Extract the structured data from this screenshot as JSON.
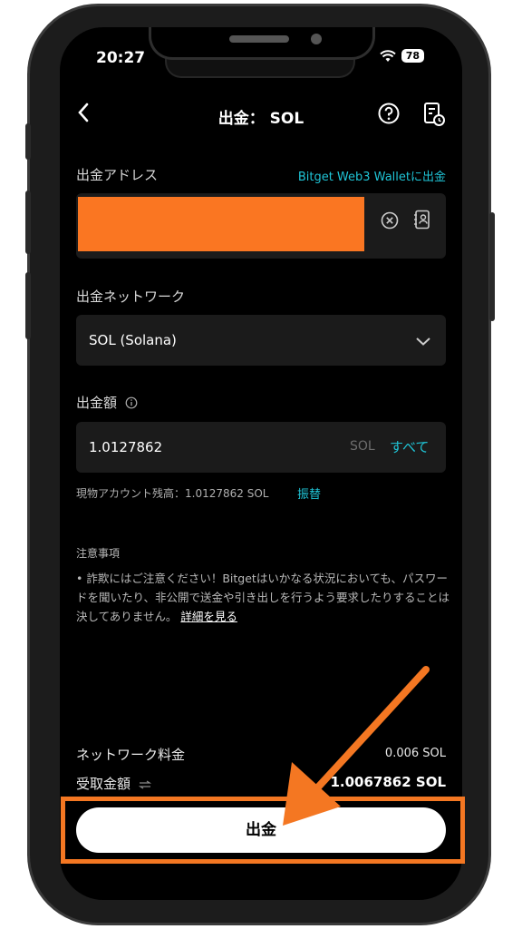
{
  "status_bar": {
    "time": "20:27",
    "battery": "78"
  },
  "header": {
    "title": "出金： SOL"
  },
  "address": {
    "label": "出金アドレス",
    "wallet_link": "Bitget Web3 Walletに出金"
  },
  "network": {
    "label": "出金ネットワーク",
    "value": "SOL (Solana)"
  },
  "amount": {
    "label": "出金額",
    "value": "1.0127862",
    "unit": "SOL",
    "all_label": "すべて"
  },
  "balance": {
    "text": "現物アカウント残高：1.0127862 SOL",
    "transfer_label": "振替"
  },
  "notes": {
    "title": "注意事項",
    "body": "• 詐欺にはご注意ください！Bitgetはいかなる状況においても、パスワードを聞いたり、非公開で送金や引き出しを行うよう要求したりすることは決してありません。",
    "link": "詳細を見る"
  },
  "fees": {
    "fee_label": "ネットワーク料金",
    "fee_value": "0.006 SOL",
    "receive_label": "受取金額",
    "receive_value": "1.0067862 SOL"
  },
  "action": {
    "withdraw_label": "出金"
  },
  "colors": {
    "accent": "#1fc4d6",
    "annotation": "#f47722",
    "redaction": "#fa7622"
  }
}
